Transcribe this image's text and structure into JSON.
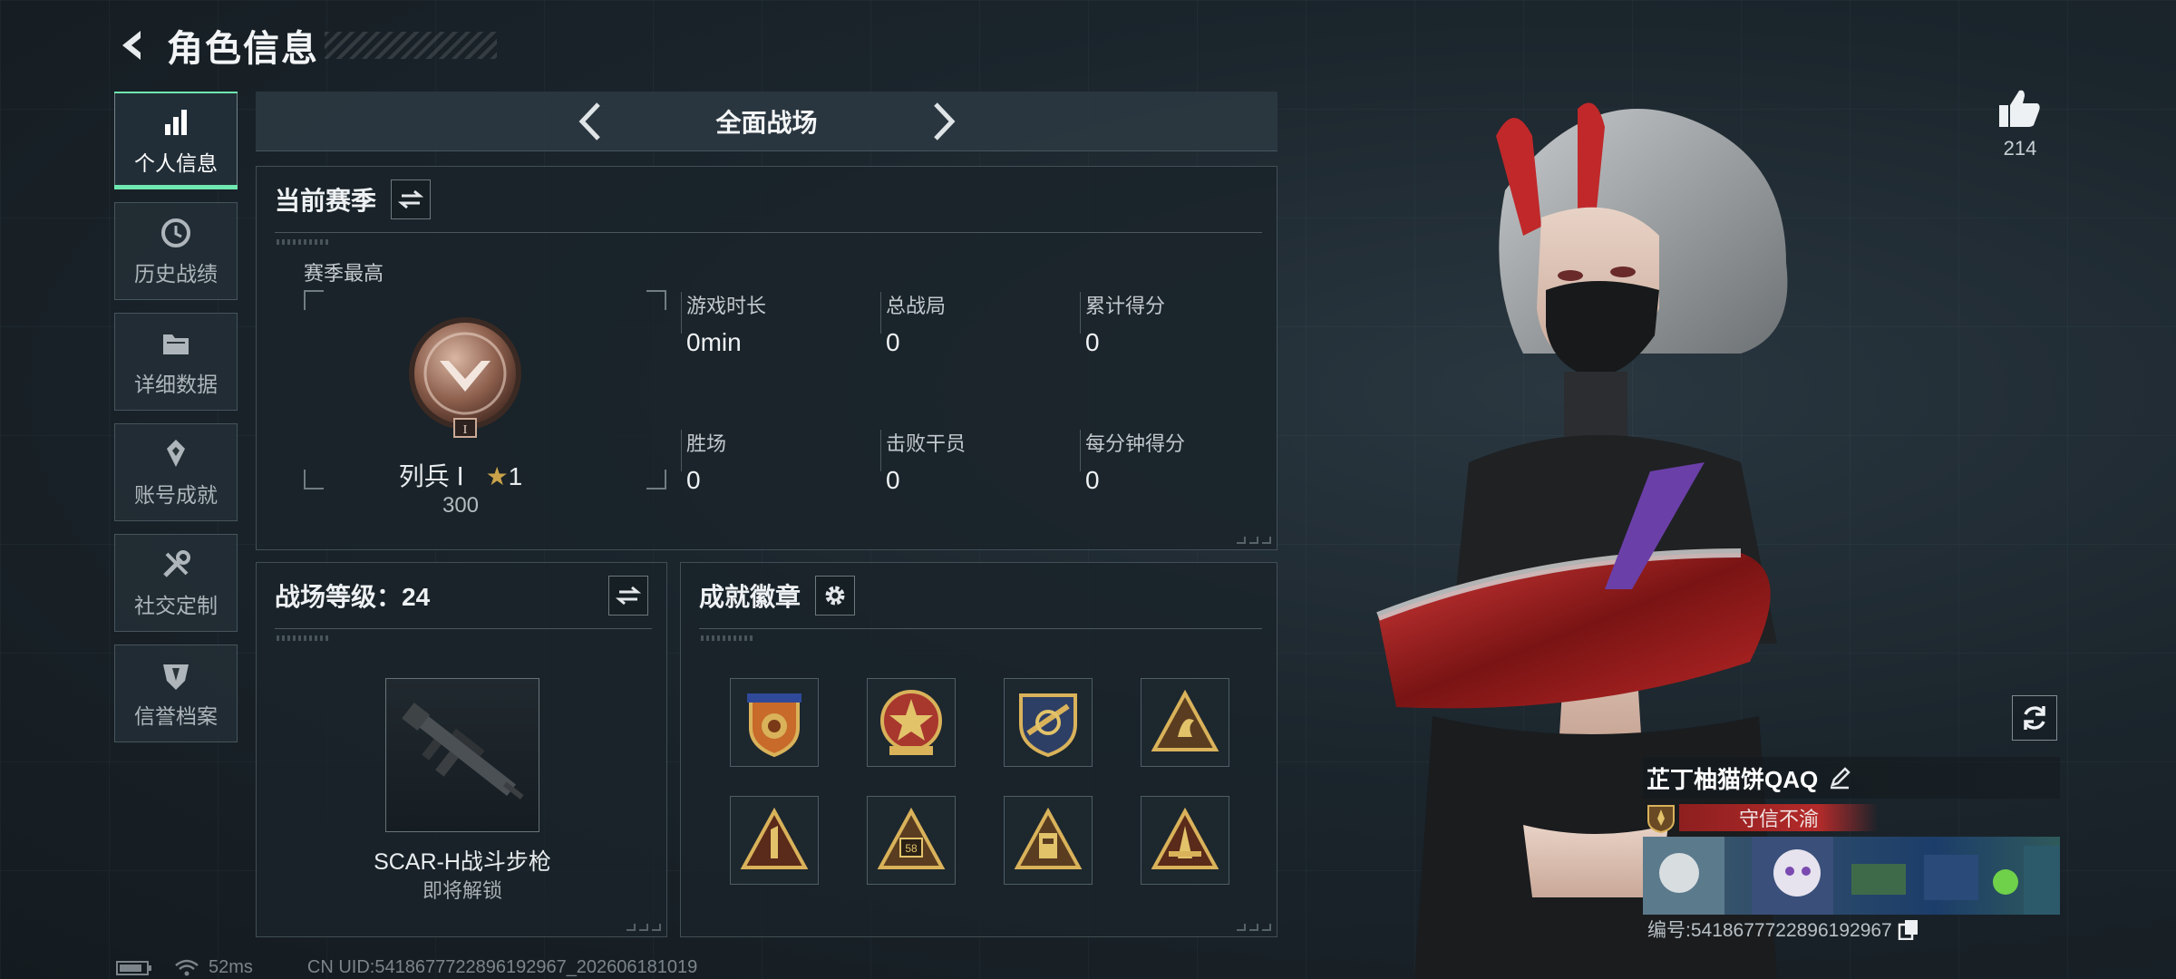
{
  "header": {
    "title": "角色信息"
  },
  "sidebar": {
    "items": [
      {
        "label": "个人信息",
        "icon": "bar-chart-icon",
        "active": true
      },
      {
        "label": "历史战绩",
        "icon": "history-icon",
        "active": false
      },
      {
        "label": "详细数据",
        "icon": "folder-icon",
        "active": false
      },
      {
        "label": "账号成就",
        "icon": "achievement-icon",
        "active": false
      },
      {
        "label": "社交定制",
        "icon": "tools-icon",
        "active": false
      },
      {
        "label": "信誉档案",
        "icon": "shield-badge-icon",
        "active": false
      }
    ]
  },
  "mode": {
    "title": "全面战场"
  },
  "season": {
    "title": "当前赛季",
    "best_label": "赛季最高",
    "rank_name": "列兵 Ⅰ",
    "rank_stars": "1",
    "rank_score": "300",
    "stats": [
      {
        "label": "游戏时长",
        "value": "0min"
      },
      {
        "label": "总战局",
        "value": "0"
      },
      {
        "label": "累计得分",
        "value": "0"
      },
      {
        "label": "胜场",
        "value": "0"
      },
      {
        "label": "击败干员",
        "value": "0"
      },
      {
        "label": "每分钟得分",
        "value": "0"
      }
    ]
  },
  "battlefield": {
    "title": "战场等级：24",
    "weapon_name": "SCAR-H战斗步枪",
    "weapon_status": "即将解锁"
  },
  "badges": {
    "title": "成就徽章",
    "items": [
      "badge-1",
      "badge-2",
      "badge-3",
      "badge-4",
      "badge-5",
      "badge-6",
      "badge-7",
      "badge-8"
    ],
    "badge_number": "58"
  },
  "likes": {
    "count": "214"
  },
  "player": {
    "name": "芷丁柚猫饼QAQ",
    "title": "守信不渝",
    "uid_label": "编号:5418677722896192967"
  },
  "status": {
    "ping": "52ms",
    "uid_line": "CN UID:5418677722896192967_202606181019"
  },
  "colors": {
    "accent": "#6fe7b0",
    "title_red": "#b42a2a",
    "gold": "#c9a24a"
  }
}
